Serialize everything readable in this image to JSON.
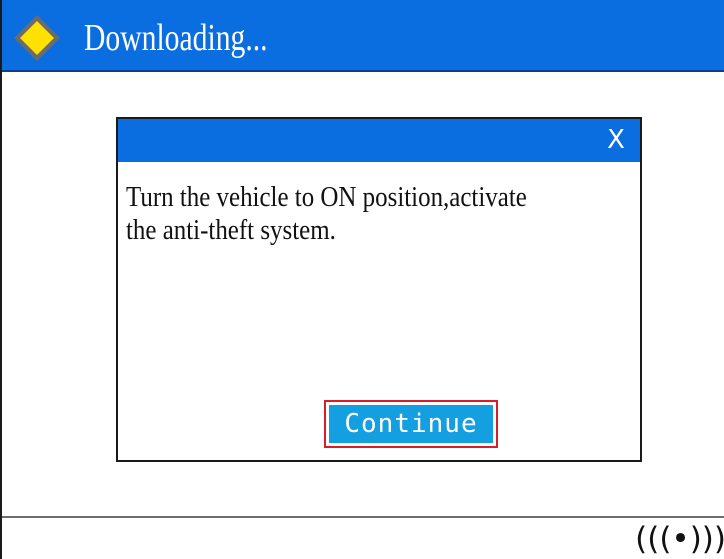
{
  "header": {
    "title": "Downloading...",
    "icon": "diamond-warning-icon"
  },
  "dialog": {
    "close_label": "X",
    "message": "Turn the vehicle to ON position,activate\nthe anti-theft system.",
    "continue_label": "Continue"
  },
  "footer": {
    "signal_icon": "wireless-signal-icon",
    "signal_text": "(((•)))"
  },
  "colors": {
    "header_blue": "#0a6ee0",
    "button_blue": "#139fe0",
    "focus_red": "#d61f2a",
    "icon_yellow": "#ffe100"
  }
}
